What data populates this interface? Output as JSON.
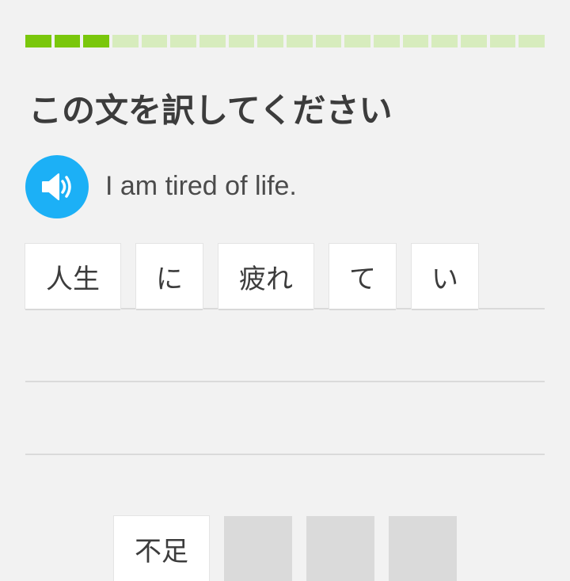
{
  "progress": {
    "completed": 3,
    "total": 18
  },
  "title": "この文を訳してください",
  "audio": {
    "icon": "speaker-icon"
  },
  "prompt": "I am tired of life.",
  "answer_tiles": [
    "人生",
    "に",
    "疲れ",
    "て",
    "い"
  ],
  "word_bank": {
    "tiles": [
      "不足"
    ],
    "empty_slots": 3
  },
  "colors": {
    "progress_done": "#7ac70c",
    "progress_todo": "#d7ecbd",
    "speaker_bg": "#1cb0f6",
    "background": "#f2f2f2"
  }
}
